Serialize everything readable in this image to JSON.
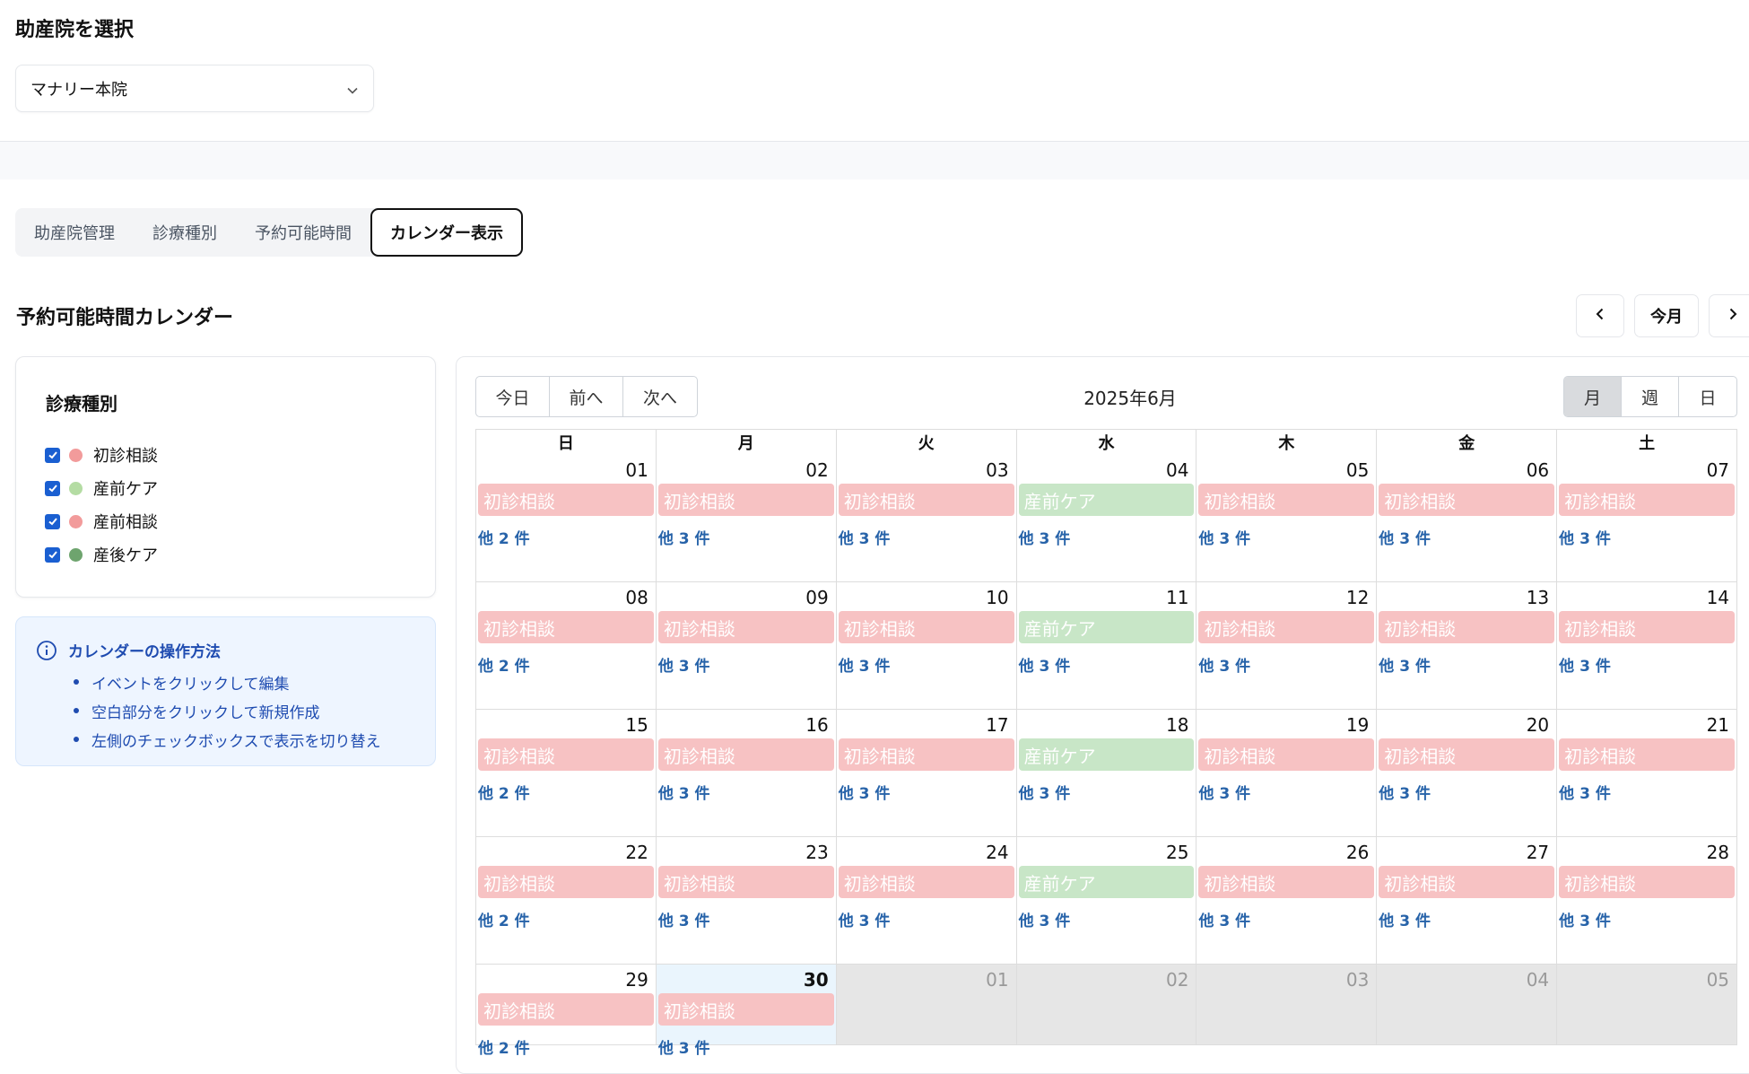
{
  "clinic_select": {
    "title": "助産院を選択",
    "selected": "マナリー本院"
  },
  "tabs": [
    {
      "label": "助産院管理",
      "active": false
    },
    {
      "label": "診療種別",
      "active": false
    },
    {
      "label": "予約可能時間",
      "active": false
    },
    {
      "label": "カレンダー表示",
      "active": true
    }
  ],
  "heading": {
    "title": "予約可能時間カレンダー",
    "prev_icon": "chevron-left-icon",
    "today_label": "今月",
    "next_icon": "chevron-right-icon"
  },
  "filter": {
    "title": "診療種別",
    "items": [
      {
        "label": "初診相談",
        "color": "#f29b9b",
        "checked": true
      },
      {
        "label": "産前ケア",
        "color": "#b4dca3",
        "checked": true
      },
      {
        "label": "産前相談",
        "color": "#f29b9b",
        "checked": true
      },
      {
        "label": "産後ケア",
        "color": "#6ea46e",
        "checked": true
      }
    ]
  },
  "info": {
    "icon": "info-icon",
    "title": "カレンダーの操作方法",
    "items": [
      "イベントをクリックして編集",
      "空白部分をクリックして新規作成",
      "左側のチェックボックスで表示を切り替え"
    ]
  },
  "calendar": {
    "toolbar_left": [
      "今日",
      "前へ",
      "次へ"
    ],
    "month_label": "2025年6月",
    "views": [
      {
        "label": "月",
        "active": true
      },
      {
        "label": "週",
        "active": false
      },
      {
        "label": "日",
        "active": false
      }
    ],
    "weekdays": [
      "日",
      "月",
      "火",
      "水",
      "木",
      "金",
      "土"
    ],
    "weeks": [
      [
        {
          "num": "01",
          "event": "初診相談",
          "color": "pink",
          "more": "他 2 件"
        },
        {
          "num": "02",
          "event": "初診相談",
          "color": "pink",
          "more": "他 3 件"
        },
        {
          "num": "03",
          "event": "初診相談",
          "color": "pink",
          "more": "他 3 件"
        },
        {
          "num": "04",
          "event": "産前ケア",
          "color": "green",
          "more": "他 3 件"
        },
        {
          "num": "05",
          "event": "初診相談",
          "color": "pink",
          "more": "他 3 件"
        },
        {
          "num": "06",
          "event": "初診相談",
          "color": "pink",
          "more": "他 3 件"
        },
        {
          "num": "07",
          "event": "初診相談",
          "color": "pink",
          "more": "他 3 件"
        }
      ],
      [
        {
          "num": "08",
          "event": "初診相談",
          "color": "pink",
          "more": "他 2 件"
        },
        {
          "num": "09",
          "event": "初診相談",
          "color": "pink",
          "more": "他 3 件"
        },
        {
          "num": "10",
          "event": "初診相談",
          "color": "pink",
          "more": "他 3 件"
        },
        {
          "num": "11",
          "event": "産前ケア",
          "color": "green",
          "more": "他 3 件"
        },
        {
          "num": "12",
          "event": "初診相談",
          "color": "pink",
          "more": "他 3 件"
        },
        {
          "num": "13",
          "event": "初診相談",
          "color": "pink",
          "more": "他 3 件"
        },
        {
          "num": "14",
          "event": "初診相談",
          "color": "pink",
          "more": "他 3 件"
        }
      ],
      [
        {
          "num": "15",
          "event": "初診相談",
          "color": "pink",
          "more": "他 2 件"
        },
        {
          "num": "16",
          "event": "初診相談",
          "color": "pink",
          "more": "他 3 件"
        },
        {
          "num": "17",
          "event": "初診相談",
          "color": "pink",
          "more": "他 3 件"
        },
        {
          "num": "18",
          "event": "産前ケア",
          "color": "green",
          "more": "他 3 件"
        },
        {
          "num": "19",
          "event": "初診相談",
          "color": "pink",
          "more": "他 3 件"
        },
        {
          "num": "20",
          "event": "初診相談",
          "color": "pink",
          "more": "他 3 件"
        },
        {
          "num": "21",
          "event": "初診相談",
          "color": "pink",
          "more": "他 3 件"
        }
      ],
      [
        {
          "num": "22",
          "event": "初診相談",
          "color": "pink",
          "more": "他 2 件"
        },
        {
          "num": "23",
          "event": "初診相談",
          "color": "pink",
          "more": "他 3 件"
        },
        {
          "num": "24",
          "event": "初診相談",
          "color": "pink",
          "more": "他 3 件"
        },
        {
          "num": "25",
          "event": "産前ケア",
          "color": "green",
          "more": "他 3 件"
        },
        {
          "num": "26",
          "event": "初診相談",
          "color": "pink",
          "more": "他 3 件"
        },
        {
          "num": "27",
          "event": "初診相談",
          "color": "pink",
          "more": "他 3 件"
        },
        {
          "num": "28",
          "event": "初診相談",
          "color": "pink",
          "more": "他 3 件"
        }
      ],
      [
        {
          "num": "29",
          "event": "初診相談",
          "color": "pink",
          "more": "他 2 件"
        },
        {
          "num": "30",
          "event": "初診相談",
          "color": "pink",
          "more": "他 3 件",
          "today": true
        },
        {
          "num": "01",
          "other": true
        },
        {
          "num": "02",
          "other": true
        },
        {
          "num": "03",
          "other": true
        },
        {
          "num": "04",
          "other": true
        },
        {
          "num": "05",
          "other": true
        }
      ]
    ]
  }
}
